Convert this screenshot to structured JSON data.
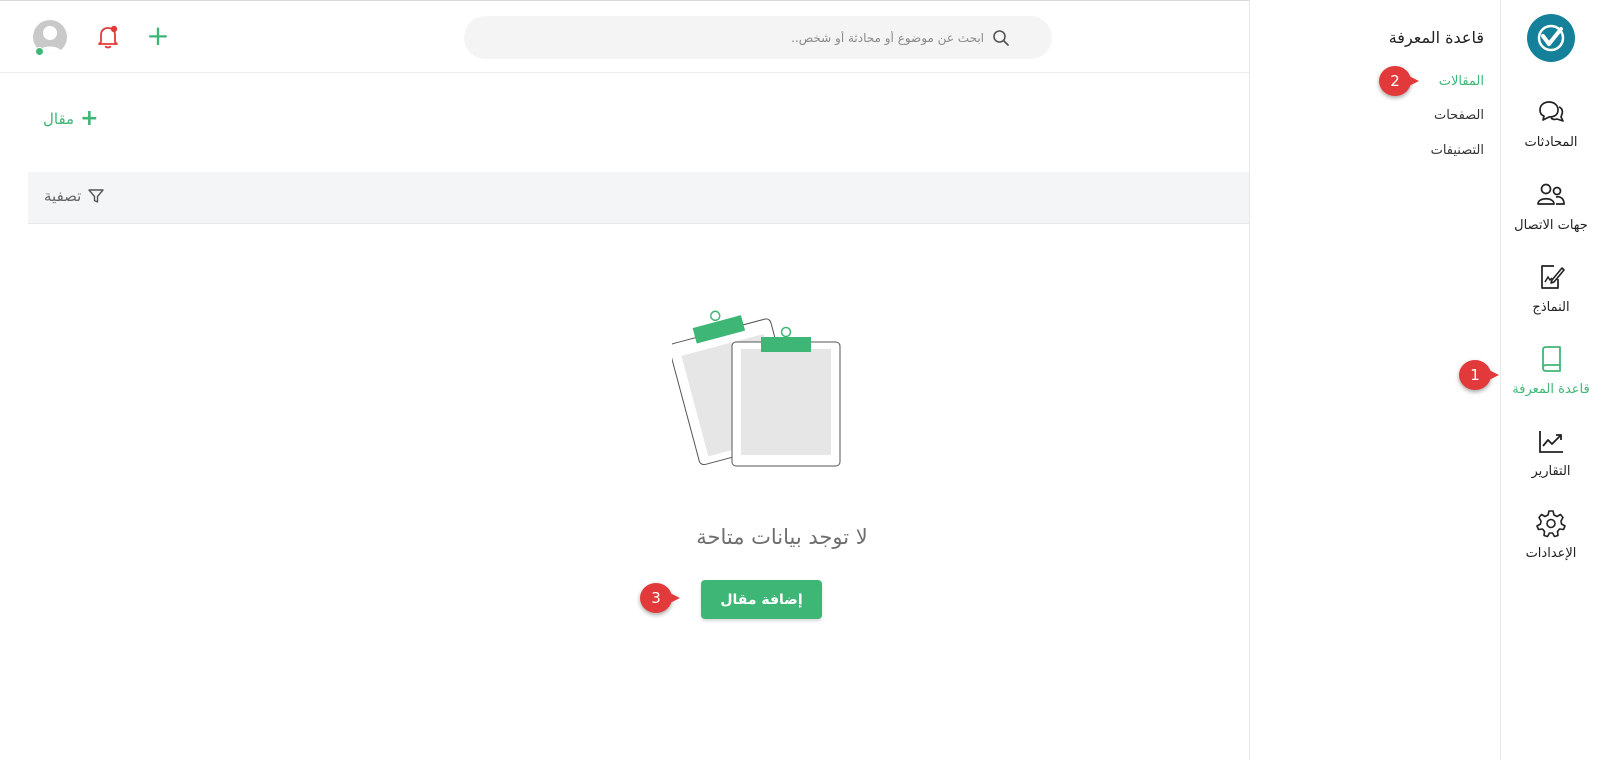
{
  "app": {
    "brand_color": "#3eb776",
    "logo_color": "#14809a"
  },
  "rail": {
    "items": [
      {
        "label": "المحادثات",
        "icon": "chat-bubbles-icon",
        "active": false
      },
      {
        "label": "جهات الاتصال",
        "icon": "contacts-icon",
        "active": false
      },
      {
        "label": "النماذج",
        "icon": "form-edit-icon",
        "active": false
      },
      {
        "label": "قاعدة المعرفة",
        "icon": "book-icon",
        "active": true
      },
      {
        "label": "التقارير",
        "icon": "chart-line-icon",
        "active": false
      },
      {
        "label": "الإعدادات",
        "icon": "gear-icon",
        "active": false
      }
    ]
  },
  "subnav": {
    "title": "قاعدة المعرفة",
    "items": [
      {
        "label": "المقالات",
        "active": true
      },
      {
        "label": "الصفحات",
        "active": false
      },
      {
        "label": "التصنيفات",
        "active": false
      }
    ]
  },
  "topbar": {
    "search_placeholder": "ابحث عن موضوع أو محادثة أو شخص.."
  },
  "content": {
    "add_article_label": "مقال",
    "filter_label": "تصفية",
    "empty_message": "لا توجد بيانات متاحة",
    "add_article_button": "إضافة مقال"
  },
  "callouts": [
    "1",
    "2",
    "3"
  ]
}
